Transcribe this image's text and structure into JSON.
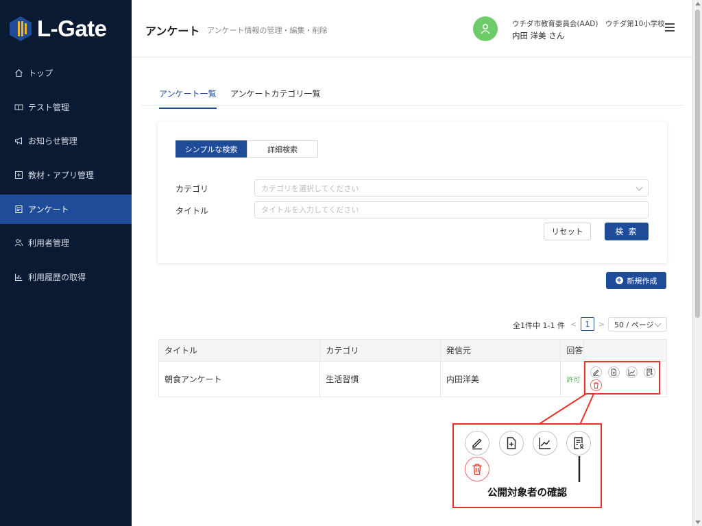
{
  "app": {
    "logo_text": "L-Gate"
  },
  "sidebar": {
    "items": [
      {
        "label": "トップ",
        "icon": "home-icon"
      },
      {
        "label": "テスト管理",
        "icon": "book-icon"
      },
      {
        "label": "お知らせ管理",
        "icon": "megaphone-icon"
      },
      {
        "label": "教材・アプリ管理",
        "icon": "app-icon"
      },
      {
        "label": "アンケート",
        "icon": "survey-icon",
        "active": true
      },
      {
        "label": "利用者管理",
        "icon": "users-icon"
      },
      {
        "label": "利用履歴の取得",
        "icon": "chart-icon"
      }
    ]
  },
  "header": {
    "title": "アンケート",
    "subtitle": "アンケート情報の管理・編集・削除",
    "org": "ウチダ市教育委員会(AAD)　ウチダ第10小学校",
    "user": "内田 洋美 さん"
  },
  "tabs": [
    {
      "label": "アンケート一覧",
      "active": true
    },
    {
      "label": "アンケートカテゴリ一覧",
      "active": false
    }
  ],
  "search": {
    "modes": [
      "シンプルな検索",
      "詳細検索"
    ],
    "category_label": "カテゴリ",
    "category_placeholder": "カテゴリを選択してください",
    "title_label": "タイトル",
    "title_placeholder": "タイトルを入力してください",
    "reset_label": "リセット",
    "search_label": "検 索"
  },
  "new_button": "新規作成",
  "pagination": {
    "total_text": "全1件中 1-1 件",
    "prev": "<",
    "current_page": "1",
    "next": ">",
    "page_size": "50 / ページ"
  },
  "table": {
    "headers": [
      "タイトル",
      "カテゴリ",
      "発信元",
      "回答"
    ],
    "rows": [
      {
        "title": "朝食アンケート",
        "category": "生活習慣",
        "sender": "内田洋美",
        "status": "許可"
      }
    ]
  },
  "callout": {
    "label": "公開対象者の確認"
  },
  "colors": {
    "sidebar": "#0b1a33",
    "primary": "#1f4c99",
    "accent_red": "#e53322",
    "avatar": "#6ecb6a"
  }
}
